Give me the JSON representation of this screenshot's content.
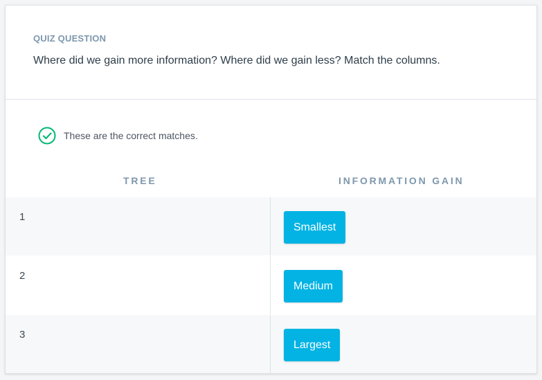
{
  "header": {
    "label": "QUIZ QUESTION",
    "question": "Where did we gain more information? Where did we gain less? Match the columns."
  },
  "feedback": {
    "icon": "check-circle-icon",
    "text": "These are the correct matches.",
    "color": "#02b875"
  },
  "table": {
    "headers": {
      "tree": "TREE",
      "gain": "INFORMATION GAIN"
    },
    "rows": [
      {
        "tree": "1",
        "gain": "Smallest"
      },
      {
        "tree": "2",
        "gain": "Medium"
      },
      {
        "tree": "3",
        "gain": "Largest"
      }
    ]
  },
  "colors": {
    "accent": "#02b3e4",
    "muted": "#7d97ad"
  }
}
